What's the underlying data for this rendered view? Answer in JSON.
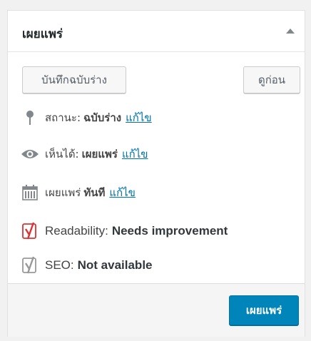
{
  "header": {
    "title": "เผยแพร่"
  },
  "actions": {
    "save_draft_label": "บันทึกฉบับร่าง",
    "preview_label": "ดูก่อน"
  },
  "status": {
    "label": "สถานะ:",
    "value": "ฉบับร่าง",
    "edit_label": "แก้ไข"
  },
  "visibility": {
    "label": "เห็นได้:",
    "value": "เผยแพร่",
    "edit_label": "แก้ไข"
  },
  "publish_time": {
    "label": "เผยแพร่",
    "value": "ทันที",
    "edit_label": "แก้ไข"
  },
  "readability": {
    "label": "Readability:",
    "value": "Needs improvement",
    "status_color": "#dc3232"
  },
  "seo": {
    "label": "SEO:",
    "value": "Not available",
    "status_color": "#999999"
  },
  "footer": {
    "publish_label": "เผยแพร่"
  },
  "colors": {
    "link": "#0073aa",
    "primary": "#0085ba"
  }
}
